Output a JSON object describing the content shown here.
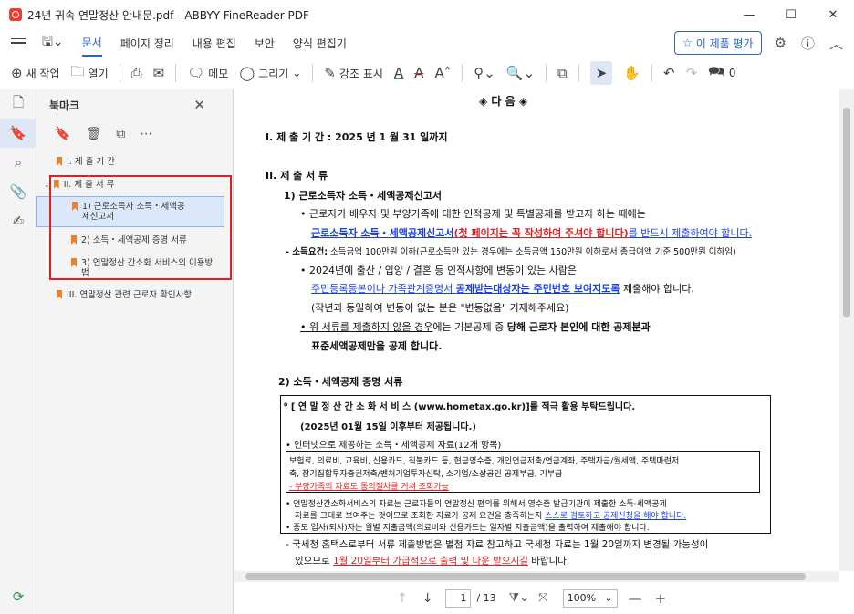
{
  "window": {
    "title": "24년 귀속 연말정산 안내문.pdf - ABBYY FineReader PDF",
    "controls": {
      "minimize": "—",
      "maximize": "☐",
      "close": "✕"
    }
  },
  "menu": {
    "tabs": [
      "문서",
      "페이지 정리",
      "내용 편집",
      "보안",
      "양식 편집기"
    ],
    "active_tab": "문서",
    "rate_button": "이 제품 평가"
  },
  "toolbar": {
    "new_task": "새 작업",
    "open": "열기",
    "memo": "메모",
    "draw": "그리기",
    "highlight": "강조 표시",
    "comment_count": "0"
  },
  "panel": {
    "title": "북마크",
    "bookmarks": [
      {
        "label": "I. 제 출 기 간",
        "level": 0
      },
      {
        "label": "II. 제 출 서 류",
        "level": 0
      },
      {
        "label": "1) 근로소득자 소득・세액공제신고서",
        "level": 1
      },
      {
        "label": "2) 소득・세액공제 증명 서류",
        "level": 1
      },
      {
        "label": "3) 연말정산 간소화 서비스의 이용방법",
        "level": 1
      },
      {
        "label": "III. 연말정산 관련 근로자 확인사항",
        "level": 0
      }
    ]
  },
  "document": {
    "heading": "◈   다        음   ◈",
    "s1": "I. 제 출 기 간  :  2025 년   1 월   31 일까지",
    "s2": "II. 제 출 서 류",
    "s2_1": "1)  근로소득자 소득・세액공제신고서",
    "l1": "• 근로자가 배우자 및 부양가족에 대한 인적공제 및 특별공제를 받고자 하는 때에는",
    "l2a": "근로소득자 소득・세액공제신고서",
    "l2b": "(첫 페이지는 꼭 작성하여 주셔야 합니다)",
    "l2c": "를 반드시 제출하여야 합니다.",
    "l3a": "- 소득요건:",
    "l3b": " 소득금액 100만원 이하(근로소득만 있는 경우에는 소득금액 150만원 이하로서 총급여액 기준 500만원 이하임)",
    "l4": "• 2024년에 출산 / 입양 / 결혼 등 인적사항에 변동이 있는 사람은",
    "l5a": "주민등록등본이나 가족관계증명서 ",
    "l5b": "공제받는대상자는 주민번호 보여지도록",
    "l5c": " 제출해야 합니다.",
    "l6": "(작년과 동일하여 변동이 없는 분은 \"변동없음\" 기재해주세요)",
    "l7a": "• 위 서류를 제출하지 않을 경우",
    "l7b": "에는 기본공제 중 ",
    "l7c": "당해 근로자 본인에 대한 공제분과",
    "l8": "표준세액공제만을 공제 합니다.",
    "s2_2": "2) 소득・세액공제 증명 서류",
    "b1": "⁰ [ 연 말 정 산 간 소 화 서 비 스  (www.hometax.go.kr)]를  적극 활용 부탁드립니다.",
    "b2": "(2025년 01월 15일 이후부터 제공됩니다.)",
    "b3": "• 인터넷으로 제공하는 소득・세액공제 자료(12개 항목)",
    "b4": "보험료, 의료비, 교육비, 신용카드, 직불카드 등, 현금영수증, 개인연금저축/연금계좌, 주택자금/월세액, 주택마련저",
    "b5": "축, 장기집합투자증권저축/벤처기업투자신탁, 소기업/소상공인 공제부금, 기부금",
    "b6": "- 부양가족의 자료도 동의절차를 거쳐 조회가능",
    "b7": "• 연말정산간소화서비스의 자료는 근로자들의 연말정산 편의를 위해서 영수증 발급기관이 제출한 소득·세액공제",
    "b8a": "자료를 그대로 보여주는 것이므로 조회한 자료가 공제 요건을 충족하는지 ",
    "b8b": "스스로 검토하고 공제신청을 해야 합니다.",
    "b9": "• 중도 입사(퇴사)자는 월별 지출금액(의료비와 신용카드는 일자별 지출금액)을 출력하여 제출해야 합니다.",
    "c1": "- 국세청 홈택스로부터 서류 제출방법은 별첨 자료 참고하고 국세청 자료는 1월 20일까지 변경될 가능성이",
    "c2a": "있으므로 ",
    "c2b": "1월 20일부터 가급적으로 출력 및 다운 받으시길",
    "c2c": " 바랍니다."
  },
  "status": {
    "page": "1",
    "total": "/ 13",
    "zoom": "100%"
  },
  "colors": {
    "accent": "#2a62c9",
    "bookmark": "#ee7f2d",
    "highlight_box": "#e02020",
    "doc_blue": "#1a3ee6",
    "doc_red": "#e02020"
  }
}
